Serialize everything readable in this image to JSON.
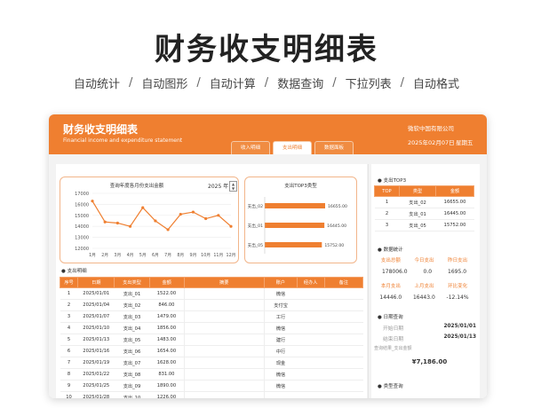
{
  "hero": {
    "title": "财务收支明细表",
    "features": [
      "自动统计",
      "自动图形",
      "自动计算",
      "数据查询",
      "下拉列表",
      "自动格式"
    ],
    "separator": "/"
  },
  "header": {
    "title": "财务收支明细表",
    "subtitle": "Financial income and expenditure statement",
    "company": "微软中国有限公司",
    "date": "2025年02月07日",
    "weekday": "星期五",
    "tabs": [
      "收入明细",
      "支出明细",
      "数据面板"
    ],
    "active_tab": 1
  },
  "colors": {
    "accent": "#ef7f30",
    "accent_light": "#f2b58a"
  },
  "line_chart": {
    "title": "查询年度各月份支出金额",
    "year_value": "2025",
    "year_unit": "年",
    "spin_up": "▲",
    "spin_down": "▼"
  },
  "bar_chart": {
    "title": "支出TOP3类型"
  },
  "chart_data": [
    {
      "type": "line",
      "categories": [
        "1月",
        "2月",
        "3月",
        "4月",
        "5月",
        "6月",
        "7月",
        "8月",
        "9月",
        "10月",
        "11月",
        "12月"
      ],
      "values": [
        16300,
        14400,
        14300,
        14000,
        15700,
        14500,
        13700,
        15100,
        15300,
        14700,
        15000,
        14000
      ],
      "title": "查询年度各月份支出金额",
      "ylim": [
        12000,
        17000
      ],
      "yticks": [
        12000,
        13000,
        14000,
        15000,
        16000,
        17000
      ],
      "grid": true
    },
    {
      "type": "bar",
      "orientation": "horizontal",
      "categories": [
        "支出_02",
        "支出_01",
        "支出_05"
      ],
      "values": [
        16655.0,
        16445.0,
        15752.0
      ],
      "value_labels": [
        "16655.00",
        "16445.00",
        "15752.00"
      ],
      "title": "支出TOP3类型"
    }
  ],
  "detail": {
    "section_title": "支出明细",
    "columns": [
      "序号",
      "日期",
      "支出类型",
      "金额",
      "摘要",
      "账户",
      "经办人",
      "备注"
    ],
    "rows": [
      [
        "1",
        "2025/01/01",
        "支出_01",
        "1522.00",
        "",
        "微信",
        "",
        ""
      ],
      [
        "2",
        "2025/01/04",
        "支出_02",
        "846.00",
        "",
        "支付宝",
        "",
        ""
      ],
      [
        "3",
        "2025/01/07",
        "支出_03",
        "1479.00",
        "",
        "工行",
        "",
        ""
      ],
      [
        "4",
        "2025/01/10",
        "支出_04",
        "1856.00",
        "",
        "微信",
        "",
        ""
      ],
      [
        "5",
        "2025/01/13",
        "支出_05",
        "1483.00",
        "",
        "建行",
        "",
        ""
      ],
      [
        "6",
        "2025/01/16",
        "支出_06",
        "1654.00",
        "",
        "中行",
        "",
        ""
      ],
      [
        "7",
        "2025/01/19",
        "支出_07",
        "1628.00",
        "",
        "现金",
        "",
        ""
      ],
      [
        "8",
        "2025/01/22",
        "支出_08",
        "831.00",
        "",
        "微信",
        "",
        ""
      ],
      [
        "9",
        "2025/01/25",
        "支出_09",
        "1890.00",
        "",
        "微信",
        "",
        ""
      ],
      [
        "10",
        "2025/01/28",
        "支出_10",
        "1226.00",
        "",
        "",
        "",
        ""
      ]
    ]
  },
  "top3": {
    "section_title": "支出TOP3",
    "columns": [
      "TOP",
      "类型",
      "金额"
    ],
    "rows": [
      [
        "1",
        "支出_02",
        "16655.00"
      ],
      [
        "2",
        "支出_01",
        "16445.00"
      ],
      [
        "3",
        "支出_05",
        "15752.00"
      ]
    ]
  },
  "stats": {
    "section_title": "数据统计",
    "row1_labels": [
      "支出总额",
      "今日支出",
      "昨日支出"
    ],
    "row1_values": [
      "178006.0",
      "0.0",
      "1695.0"
    ],
    "row2_labels": [
      "本月支出",
      "上月支出",
      "环比变化"
    ],
    "row2_values": [
      "14446.0",
      "16443.0",
      "-12.14%"
    ]
  },
  "date_query": {
    "section_title": "日期查询",
    "start_label": "开始日期",
    "start_value": "2025/01/01",
    "end_label": "结束日期",
    "end_value": "2025/01/13",
    "result_label": "查询结果_支出金额",
    "result_value": "¥7,186.00"
  },
  "type_query": {
    "section_title": "类型查询"
  }
}
